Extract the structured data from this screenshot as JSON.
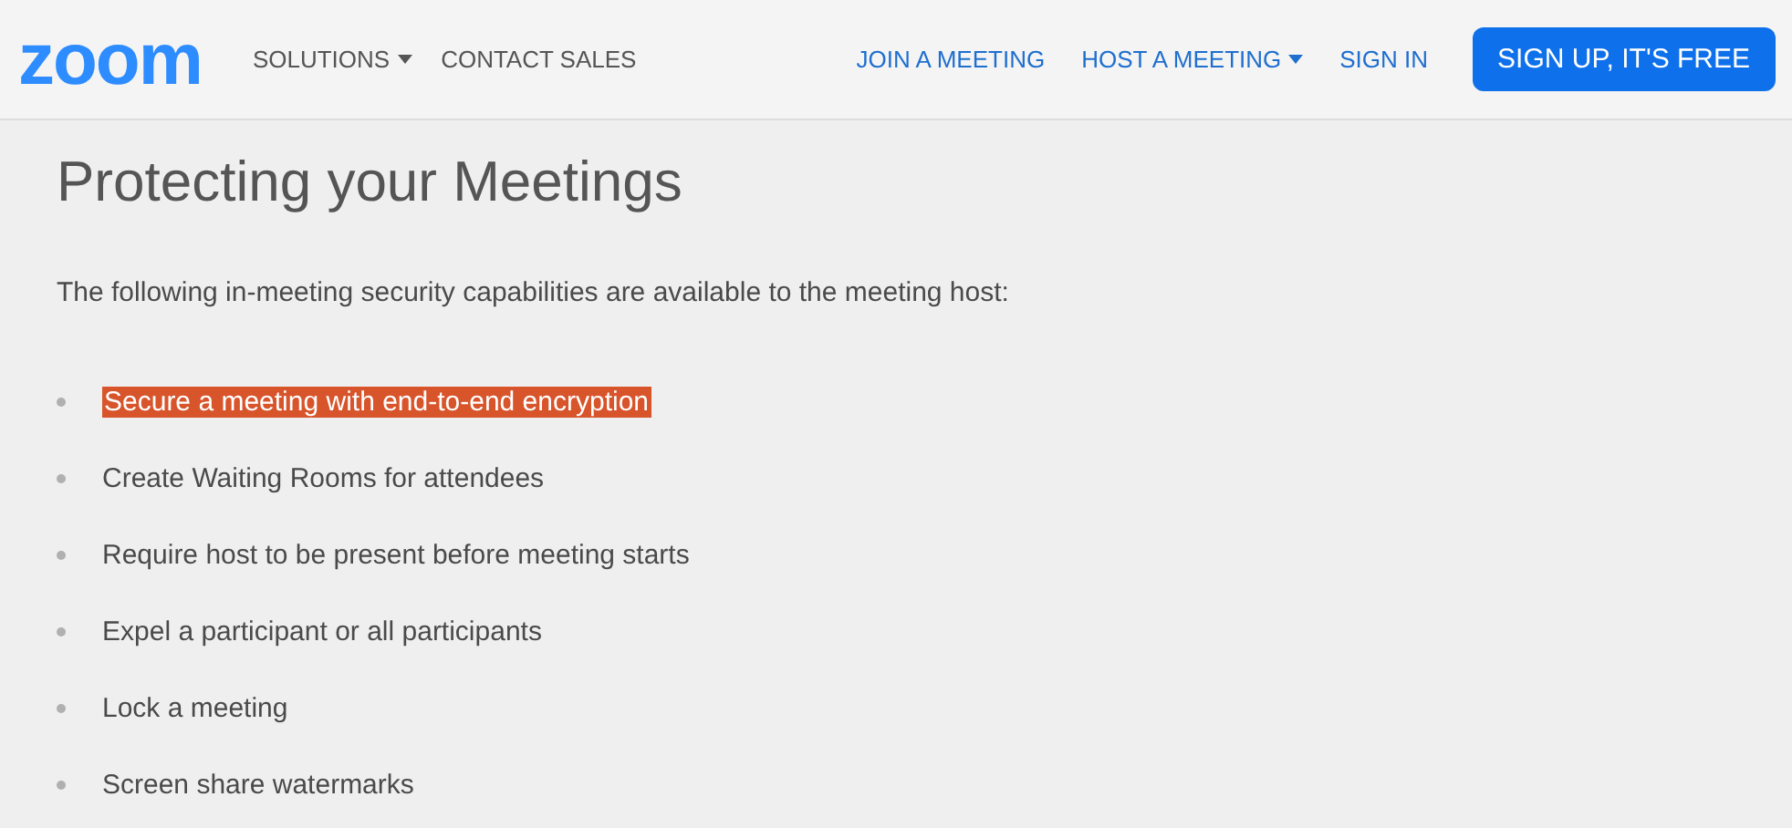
{
  "header": {
    "logo": "zoom",
    "nav_left": [
      {
        "label": "SOLUTIONS",
        "dropdown": true
      },
      {
        "label": "CONTACT SALES",
        "dropdown": false
      }
    ],
    "nav_right": [
      {
        "label": "JOIN A MEETING",
        "dropdown": false
      },
      {
        "label": "HOST A MEETING",
        "dropdown": true
      },
      {
        "label": "SIGN IN",
        "dropdown": false
      }
    ],
    "cta": "SIGN UP, IT'S FREE"
  },
  "title": "Protecting your Meetings",
  "intro": "The following in-meeting security capabilities are available to the meeting host:",
  "items": [
    {
      "text": "Secure a meeting with end-to-end encryption",
      "highlighted": true
    },
    {
      "text": "Create Waiting Rooms for attendees",
      "highlighted": false
    },
    {
      "text": "Require host to be present before meeting starts",
      "highlighted": false
    },
    {
      "text": "Expel a participant or all participants",
      "highlighted": false
    },
    {
      "text": "Lock a meeting",
      "highlighted": false
    },
    {
      "text": "Screen share watermarks",
      "highlighted": false
    }
  ]
}
